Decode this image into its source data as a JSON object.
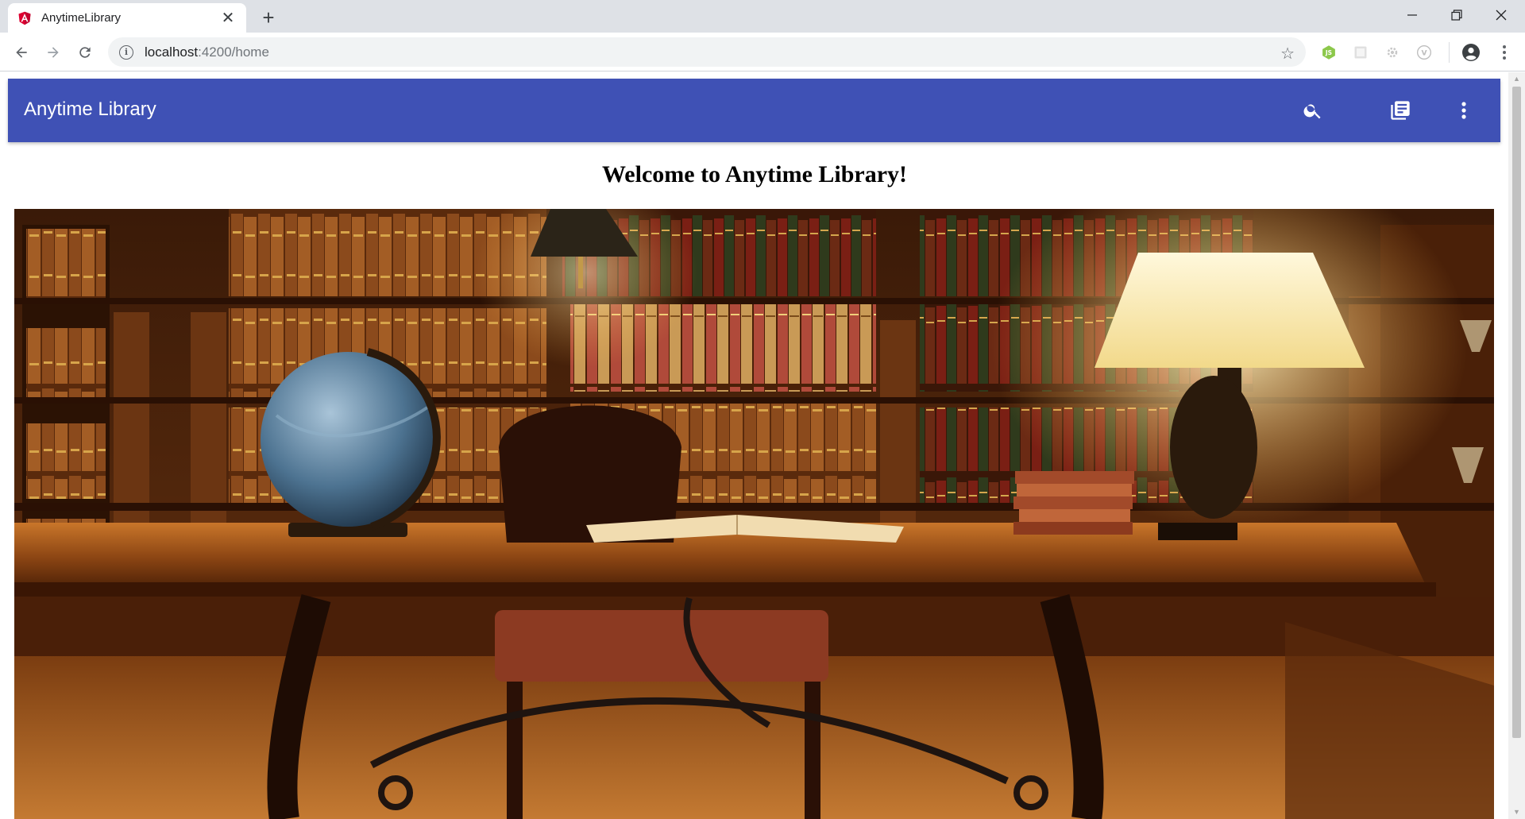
{
  "browser": {
    "tab_title": "AnytimeLibrary",
    "tab_close": "✕",
    "new_tab": "+",
    "url_host": "localhost",
    "url_path": ":4200/home",
    "favicon": "angular-icon",
    "extensions": [
      "nodejs-extension-icon",
      "extension-icon",
      "gear-extension-icon",
      "vue-extension-icon"
    ]
  },
  "app": {
    "title": "Anytime Library",
    "theme_color": "#3f51b5",
    "toolbar_icons": [
      "search-icon",
      "library-books-icon",
      "more-vert-icon"
    ]
  },
  "page": {
    "heading": "Welcome to Anytime Library!",
    "hero_image": "library-room-photo"
  }
}
